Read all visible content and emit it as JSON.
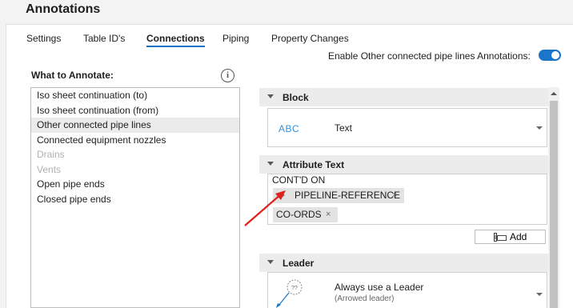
{
  "header": {
    "title": "Annotations"
  },
  "tabs": [
    {
      "label": "Settings"
    },
    {
      "label": "Table ID's"
    },
    {
      "label": "Connections"
    },
    {
      "label": "Piping"
    },
    {
      "label": "Property Changes"
    }
  ],
  "active_tab": "Connections",
  "toggle": {
    "label": "Enable Other connected pipe lines Annotations:",
    "on": true
  },
  "what_to_annotate": {
    "title": "What to Annotate:",
    "info_icon": "info-icon",
    "items": [
      {
        "label": "Iso sheet continuation (to)",
        "state": "normal"
      },
      {
        "label": "Iso sheet continuation (from)",
        "state": "normal"
      },
      {
        "label": "Other connected pipe lines",
        "state": "selected"
      },
      {
        "label": "Connected equipment nozzles",
        "state": "normal"
      },
      {
        "label": "Drains",
        "state": "disabled"
      },
      {
        "label": "Vents",
        "state": "disabled"
      },
      {
        "label": "Open pipe ends",
        "state": "normal"
      },
      {
        "label": "Closed pipe ends",
        "state": "normal"
      }
    ]
  },
  "block": {
    "header": "Block",
    "icon_text": "ABC",
    "value": "Text"
  },
  "attribute_text": {
    "header": "Attribute Text",
    "prefix": "CONT'D ON",
    "chips": [
      {
        "label": "PIPELINE-REFERENCE",
        "remove": "×"
      },
      {
        "label": "CO-ORDS",
        "remove": "×"
      }
    ],
    "add_button": "Add"
  },
  "leader": {
    "header": "Leader",
    "icon_text": "??",
    "value": "Always use a Leader",
    "subvalue": "(Arrowed leader)"
  },
  "colors": {
    "accent": "#1b75c8",
    "annotation_arrow": "#e0201b",
    "abc_text": "#3a8fd6"
  }
}
